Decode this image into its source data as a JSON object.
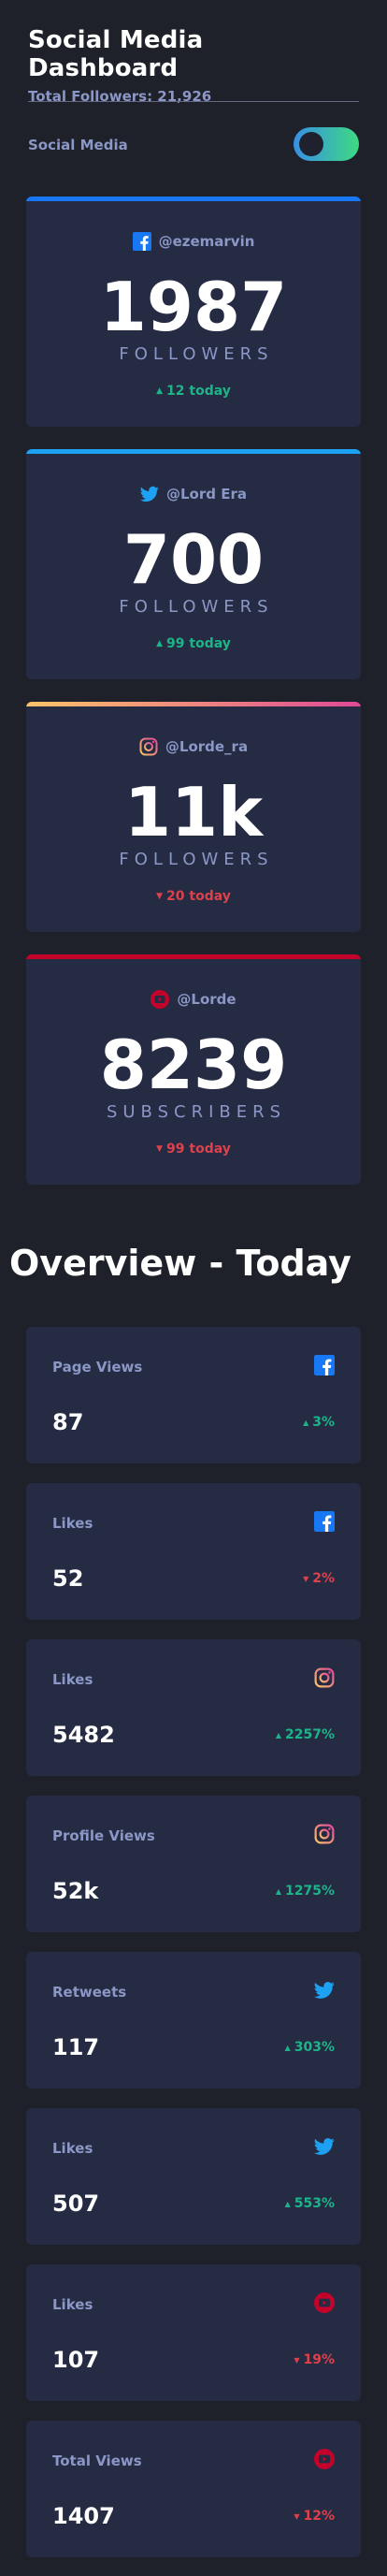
{
  "header": {
    "title": "Social Media Dashboard",
    "total_followers": "Total Followers: 21,926"
  },
  "toggle": {
    "label": "Social Media"
  },
  "colors": {
    "facebook": "#1877f2",
    "twitter": "#1da1f2",
    "instagram_gradient": [
      "#fdc468",
      "#df4996"
    ],
    "youtube": "#c4032b",
    "up": "#1db489",
    "down": "#dc414c"
  },
  "follower_cards": [
    {
      "network": "facebook",
      "icon": "facebook-icon",
      "handle": "@ezemarvin",
      "count": "1987",
      "unit": "FOLLOWERS",
      "change": "12 today",
      "direction": "up"
    },
    {
      "network": "twitter",
      "icon": "twitter-icon",
      "handle": "@Lord Era",
      "count": "700",
      "unit": "FOLLOWERS",
      "change": "99 today",
      "direction": "up"
    },
    {
      "network": "instagram",
      "icon": "instagram-icon",
      "handle": "@Lorde_ra",
      "count": "11k",
      "unit": "FOLLOWERS",
      "change": "20 today",
      "direction": "down"
    },
    {
      "network": "youtube",
      "icon": "youtube-icon",
      "handle": "@Lorde",
      "count": "8239",
      "unit": "SUBSCRIBERS",
      "change": "99 today",
      "direction": "down"
    }
  ],
  "overview": {
    "title": "Overview - Today",
    "cards": [
      {
        "label": "Page Views",
        "icon": "facebook-icon",
        "value": "87",
        "percent": "3%",
        "direction": "up"
      },
      {
        "label": "Likes",
        "icon": "facebook-icon",
        "value": "52",
        "percent": "2%",
        "direction": "down"
      },
      {
        "label": "Likes",
        "icon": "instagram-icon",
        "value": "5482",
        "percent": "2257%",
        "direction": "up"
      },
      {
        "label": "Profile Views",
        "icon": "instagram-icon",
        "value": "52k",
        "percent": "1275%",
        "direction": "up"
      },
      {
        "label": "Retweets",
        "icon": "twitter-icon",
        "value": "117",
        "percent": "303%",
        "direction": "up"
      },
      {
        "label": "Likes",
        "icon": "twitter-icon",
        "value": "507",
        "percent": "553%",
        "direction": "up"
      },
      {
        "label": "Likes",
        "icon": "youtube-icon",
        "value": "107",
        "percent": "19%",
        "direction": "down"
      },
      {
        "label": "Total Views",
        "icon": "youtube-icon",
        "value": "1407",
        "percent": "12%",
        "direction": "down"
      }
    ]
  }
}
